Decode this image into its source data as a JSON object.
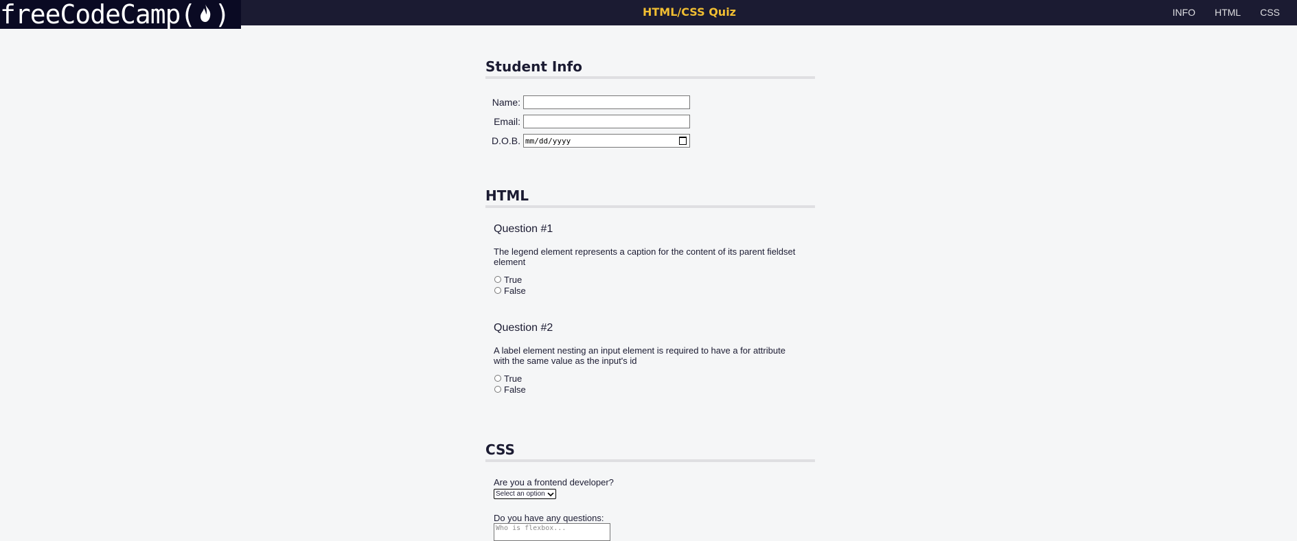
{
  "header": {
    "logo_text": "freeCodeCamp(",
    "logo_close": ")",
    "title": "HTML/CSS Quiz",
    "nav": [
      "INFO",
      "HTML",
      "CSS"
    ]
  },
  "student_info": {
    "heading": "Student Info",
    "name_label": "Name:",
    "email_label": "Email:",
    "dob_label": "D.O.B.",
    "dob_placeholder": "mm/dd/yyyy"
  },
  "html": {
    "heading": "HTML",
    "questions": [
      {
        "title": "Question #1",
        "text": "The legend element represents a caption for the content of its parent fieldset element",
        "options": [
          "True",
          "False"
        ]
      },
      {
        "title": "Question #2",
        "text": "A label element nesting an input element is required to have a for attribute with the same value as the input's id",
        "options": [
          "True",
          "False"
        ]
      }
    ]
  },
  "css": {
    "heading": "CSS",
    "frontend_label": "Are you a frontend developer?",
    "select_value": "Select an option",
    "questions_label": "Do you have any questions:",
    "textarea_placeholder": "Who is flexbox..."
  }
}
